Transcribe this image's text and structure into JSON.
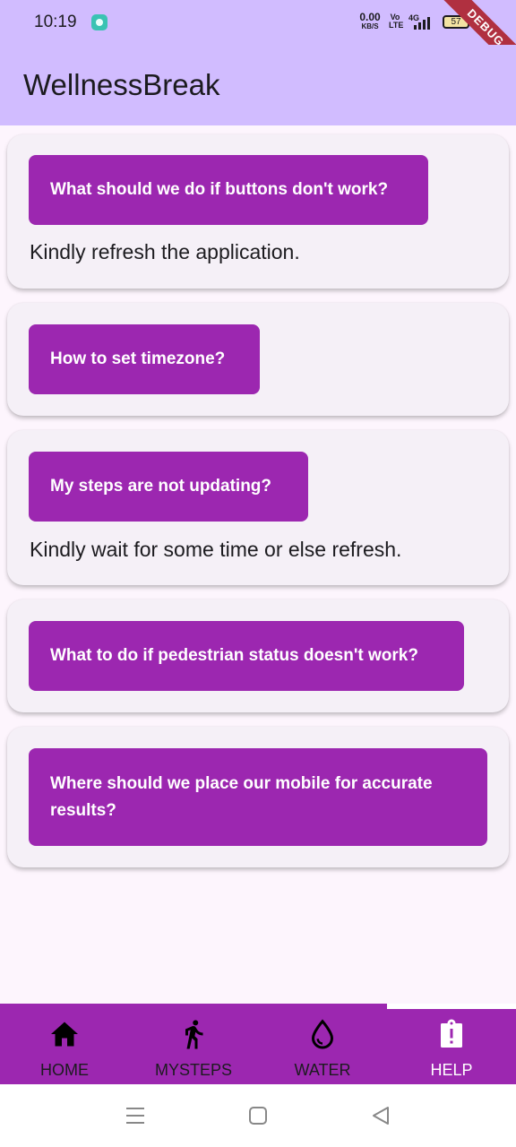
{
  "status_bar": {
    "time": "10:19",
    "net_speed": "0.00",
    "net_unit": "KB/S",
    "volte": "Vo LTE",
    "signal": "4G",
    "battery": "57",
    "debug_banner": "DEBUG"
  },
  "app_bar": {
    "title": "WellnessBreak"
  },
  "faqs": [
    {
      "question": "What should we do if buttons don't work?",
      "answer": "Kindly refresh the application."
    },
    {
      "question": "How to set timezone?",
      "answer": ""
    },
    {
      "question": "My steps are not updating?",
      "answer": "Kindly wait for some time or else refresh."
    },
    {
      "question": "What to do if pedestrian status doesn't work?",
      "answer": ""
    },
    {
      "question": "Where should we place our mobile for accurate results?",
      "answer": ""
    }
  ],
  "bottom_nav": {
    "selected": "HELP",
    "items": [
      {
        "label": "HOME",
        "icon": "home-icon"
      },
      {
        "label": "MYSTEPS",
        "icon": "walking-icon"
      },
      {
        "label": "WATER",
        "icon": "water-drop-icon"
      },
      {
        "label": "HELP",
        "icon": "help-clipboard-icon"
      }
    ]
  },
  "colors": {
    "app_bar": "#d1bcff",
    "accent": "#9c27b0",
    "card": "#f5f0f7",
    "background": "#fdf5fd"
  }
}
